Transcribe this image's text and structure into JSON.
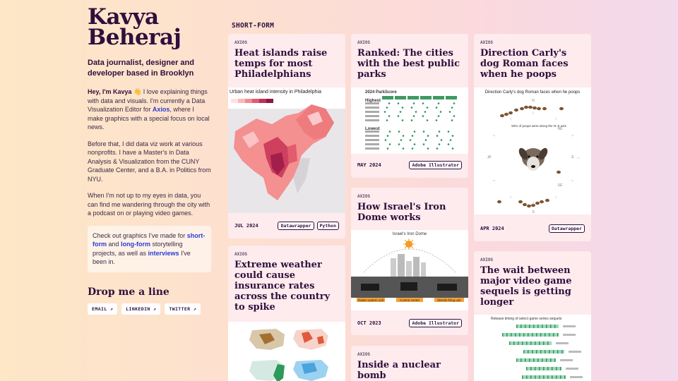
{
  "profile": {
    "name_line1": "Kavya",
    "name_line2": "Beheraj",
    "tagline": "Data journalist, designer and developer based in Brooklyn",
    "bio1_hey": "Hey, I'm Kavya 👋",
    "bio1_text": " I love explaining things with data and visuals. I'm currently a Data Visualization Editor for ",
    "bio1_link": "Axios",
    "bio1_end": ", where I make graphics with a special focus on local news.",
    "bio2": "Before that, I did data viz work at various nonprofits. I have a Master's in Data Analysis & Visualization from the CUNY Graduate Center, and a B.A. in Politics from NYU.",
    "bio3": "When I'm not up to my eyes in data, you can find me wandering through the city with a podcast on or playing video games.",
    "callout_pre": "Check out graphics I've made for ",
    "callout_link1": "short-form",
    "callout_and": " and ",
    "callout_link2": "long-form",
    "callout_mid": " storytelling projects, as well as ",
    "callout_link3": "interviews",
    "callout_end": " I've been in.",
    "drop_title": "Drop me a line",
    "contacts": [
      "EMAIL ↗",
      "LINKEDIN ↗",
      "TWITTER ↗"
    ]
  },
  "section_title": "SHORT-FORM",
  "cards": [
    {
      "source": "AXIOS",
      "title": "Heat islands raise temps for most Philadelphians",
      "image_title": "Urban heat island intensity in Philadelphia",
      "date": "JUL 2024",
      "tags": [
        "Datawrapper",
        "Python"
      ]
    },
    {
      "source": "AXIOS",
      "title": "Extreme weather could cause insurance rates across the country to spike"
    },
    {
      "source": "AXIOS",
      "title": "Ranked: The cities with the best public parks",
      "image_title": "2024 ParkScore",
      "image_highest": "Highest",
      "image_lowest": "Lowest",
      "date": "MAY 2024",
      "tags": [
        "Adobe Illustrator"
      ]
    },
    {
      "source": "AXIOS",
      "title": "How Israel's Iron Dome works",
      "image_title": "Israel's Iron Dome",
      "image_labels": [
        "Radar system unit",
        "Control center",
        "Missile firing unit"
      ],
      "date": "OCT 2023",
      "tags": [
        "Adobe Illustrator"
      ]
    },
    {
      "source": "AXIOS",
      "title": "Inside a nuclear bomb"
    },
    {
      "source": "AXIOS",
      "title": "Direction Carly's dog Roman faces when he poops",
      "image_title": "Direction Carly's dog Roman faces when he poops",
      "image_note": "50% of poops were along the N–S axis",
      "compass": [
        "N",
        "NE",
        "E",
        "SE",
        "S",
        "W"
      ],
      "date": "APR 2024",
      "tags": [
        "Datawrapper"
      ]
    },
    {
      "source": "AXIOS",
      "title": "The wait between major video game sequels is getting longer",
      "image_title": "Release timing of select game series sequels"
    }
  ]
}
